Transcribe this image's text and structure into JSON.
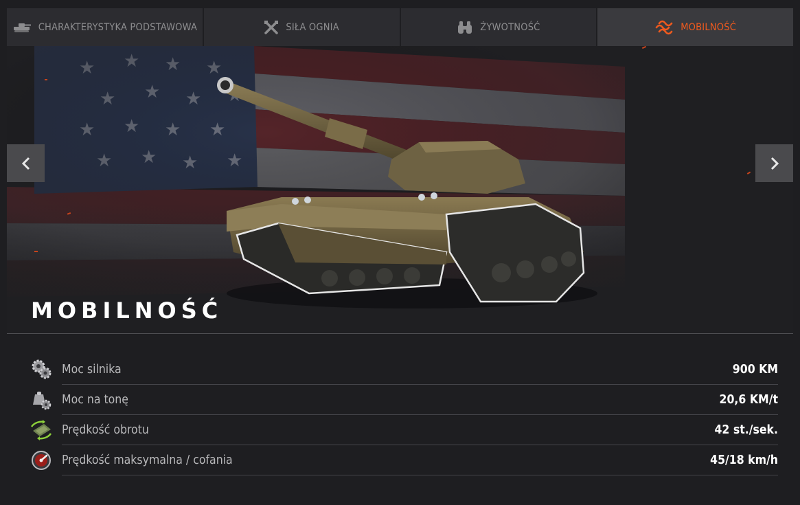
{
  "tabs": [
    {
      "label": "CHARAKTERYSTYKA PODSTAWOWA",
      "icon": "tank-icon",
      "active": false
    },
    {
      "label": "SIŁA OGNIA",
      "icon": "crossed-guns-icon",
      "active": false
    },
    {
      "label": "ŻYWOTNOŚĆ",
      "icon": "binoculars-icon",
      "active": false
    },
    {
      "label": "MOBILNOŚĆ",
      "icon": "speed-waves-icon",
      "active": true
    }
  ],
  "hero": {
    "title": "MOBILNOŚĆ",
    "nav_prev_icon": "chevron-left-icon",
    "nav_next_icon": "chevron-right-icon"
  },
  "stats": [
    {
      "label": "Moc silnika",
      "value": "900 KM",
      "icon": "gears-icon"
    },
    {
      "label": "Moc na tonę",
      "value": "20,6 KM/t",
      "icon": "weight-gear-icon"
    },
    {
      "label": "Prędkość obrotu",
      "value": "42 st./sek.",
      "icon": "rotation-icon"
    },
    {
      "label": "Prędkość maksymalna / cofania",
      "value": "45/18 km/h",
      "icon": "speedometer-icon"
    }
  ],
  "colors": {
    "accent": "#f05a1e",
    "background": "#1e1e21",
    "tab_bg": "#2c2c30",
    "tab_active_bg": "#3a3a3e"
  }
}
